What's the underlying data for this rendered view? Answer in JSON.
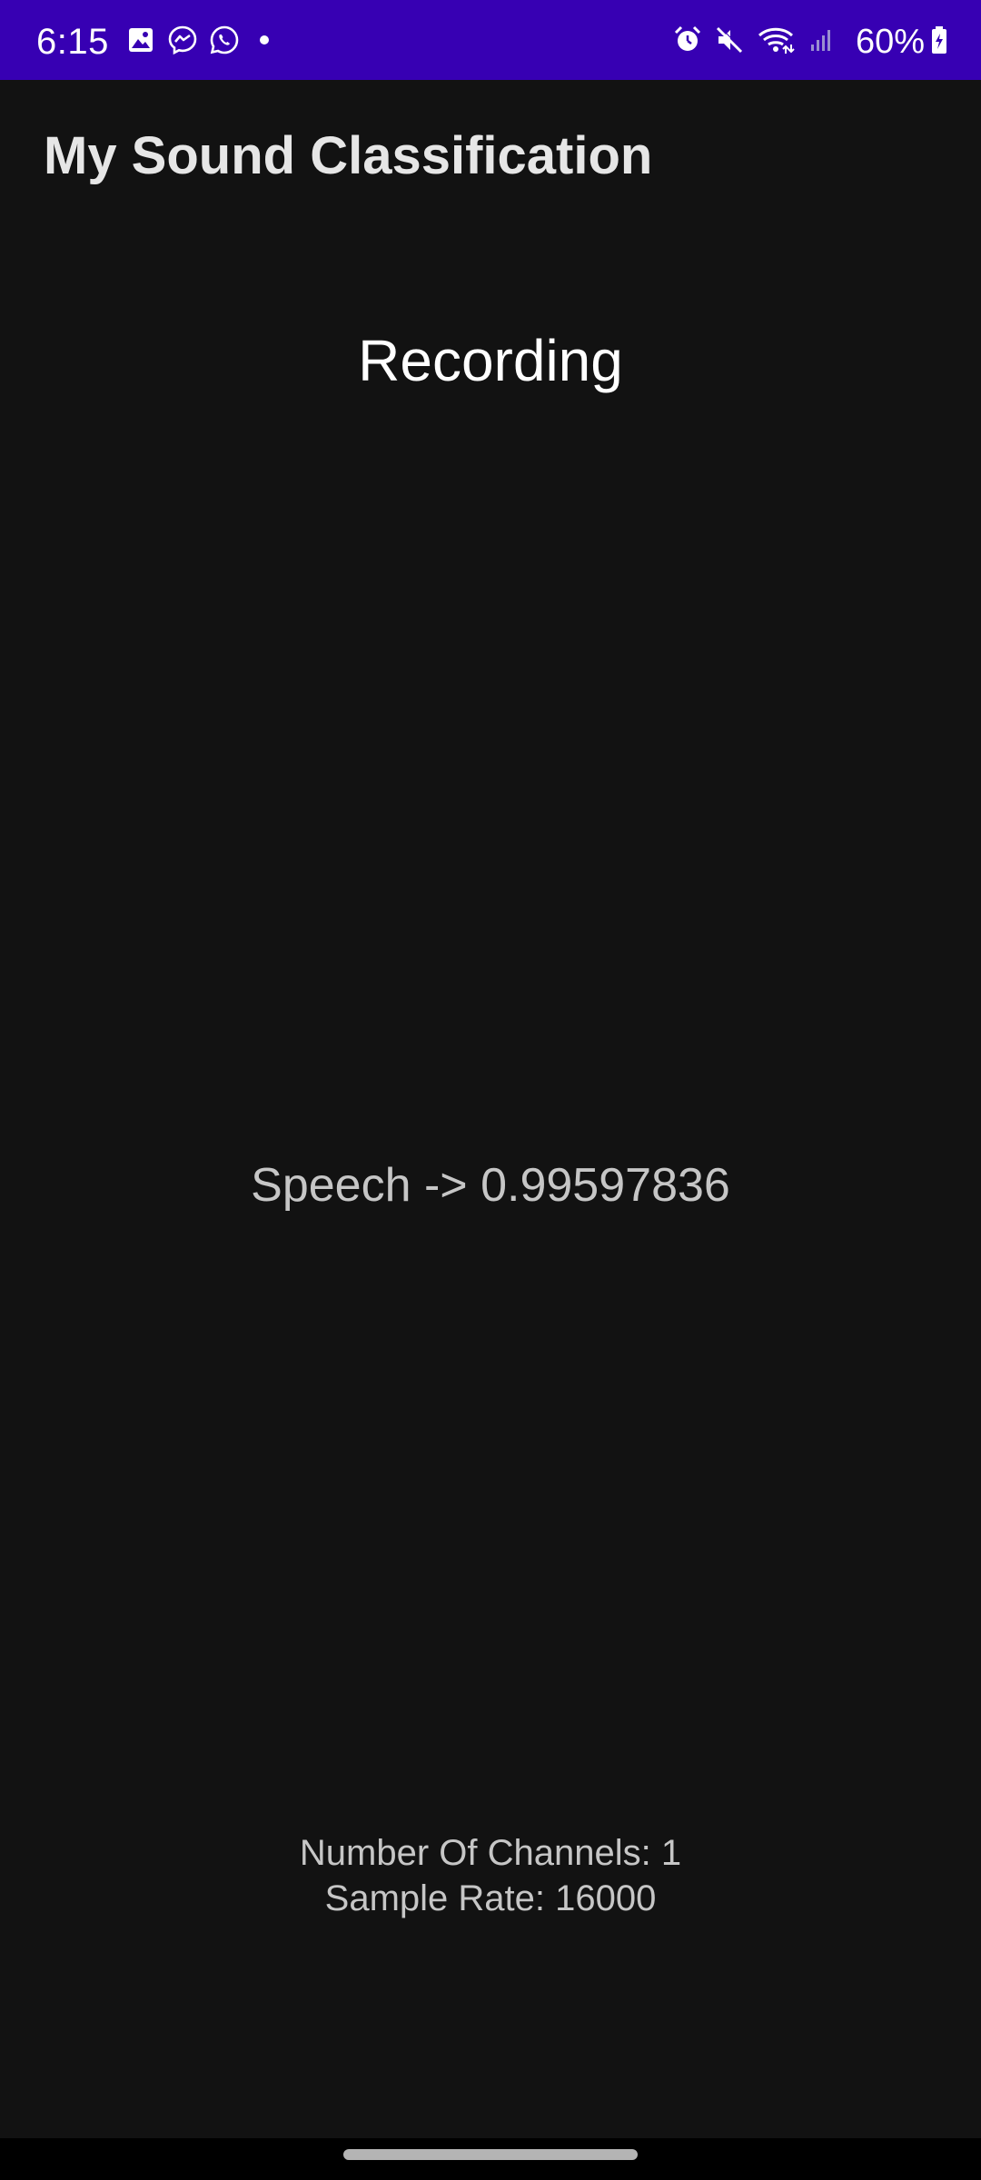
{
  "status_bar": {
    "time": "6:15",
    "battery": "60%",
    "left_icons": [
      "gallery-icon",
      "messenger-icon",
      "whatsapp-icon",
      "notification-dot-icon"
    ],
    "right_icons": [
      "alarm-icon",
      "mute-icon",
      "wifi-icon",
      "signal-icon",
      "battery-icon"
    ],
    "background": "#3700b3"
  },
  "app_bar": {
    "title": "My Sound Classification"
  },
  "main": {
    "status": "Recording",
    "result": "Speech -> 0.99597836",
    "channels": "Number Of Channels: 1",
    "sample_rate": "Sample Rate: 16000"
  },
  "theme": {
    "background": "#121212",
    "text_primary": "#ffffff",
    "text_secondary": "#c6c6c6"
  }
}
